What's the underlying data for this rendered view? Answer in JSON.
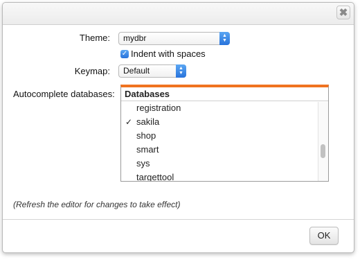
{
  "dialog": {
    "close_label": "✖"
  },
  "theme": {
    "label": "Theme:",
    "value": "mydbr"
  },
  "indent": {
    "checked": true,
    "label": "Indent with spaces"
  },
  "keymap": {
    "label": "Keymap:",
    "value": "Default"
  },
  "autocomplete": {
    "label": "Autocomplete databases:",
    "header": "Databases",
    "items": [
      {
        "check": "",
        "name": "registration"
      },
      {
        "check": "✓",
        "name": "sakila"
      },
      {
        "check": "",
        "name": "shop"
      },
      {
        "check": "",
        "name": "smart"
      },
      {
        "check": "",
        "name": "sys"
      },
      {
        "check": "",
        "name": "targettool"
      }
    ]
  },
  "note": "(Refresh the editor for changes to take effect)",
  "ok_label": "OK",
  "colors": {
    "accent_orange": "#f07320",
    "select_blue": "#2873db"
  }
}
